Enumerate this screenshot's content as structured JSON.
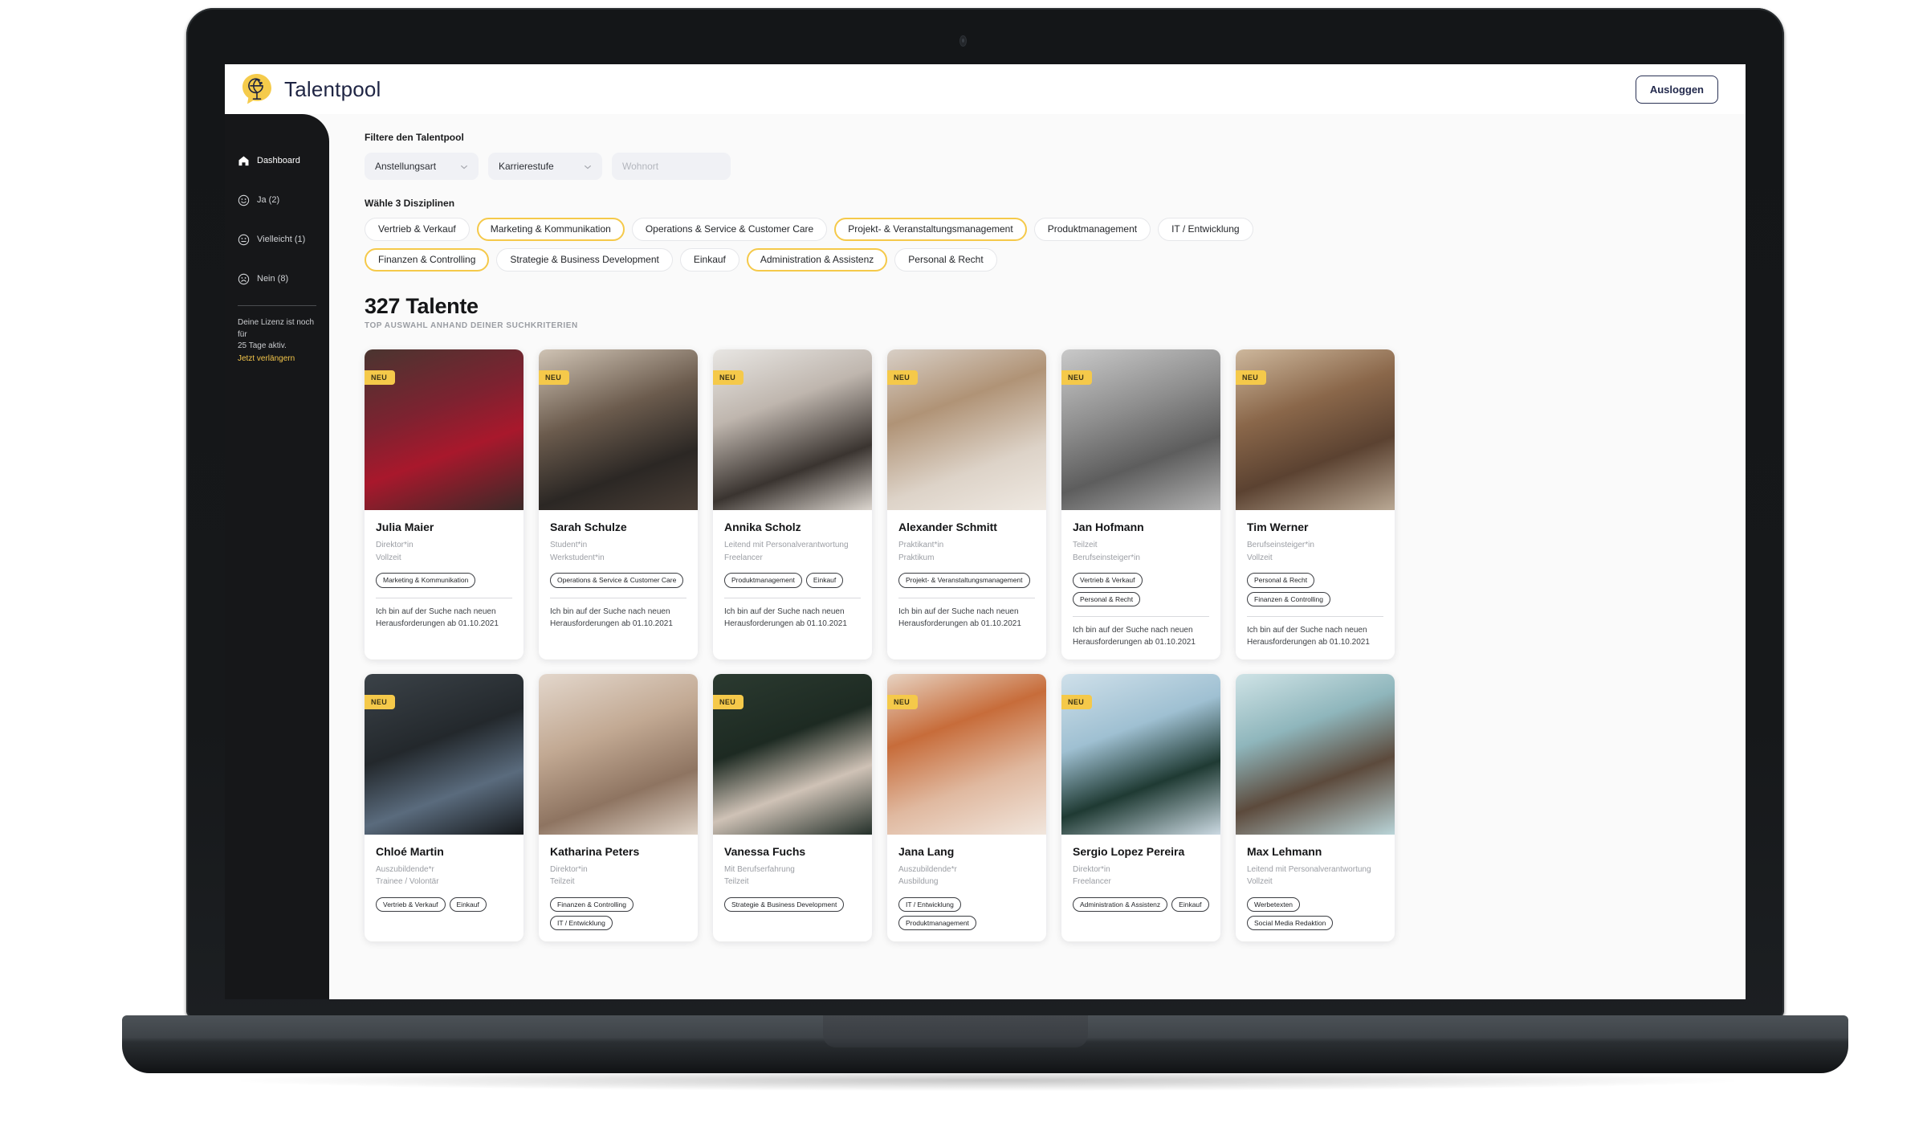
{
  "brand": {
    "name": "Talentpool",
    "logo_icon": "globe-speech-bubble-icon"
  },
  "topbar": {
    "logout_label": "Ausloggen"
  },
  "sidebar": {
    "items": [
      {
        "label": "Dashboard",
        "icon": "home-icon"
      },
      {
        "label": "Ja (2)",
        "icon": "smiley-happy-icon"
      },
      {
        "label": "Vielleicht (1)",
        "icon": "smiley-neutral-icon"
      },
      {
        "label": "Nein (8)",
        "icon": "smiley-sad-icon"
      }
    ],
    "license": {
      "line1": "Deine Lizenz ist noch für",
      "line2": "25 Tage aktiv.",
      "renew_label": "Jetzt verlängern"
    }
  },
  "filters": {
    "heading": "Filtere den Talentpool",
    "employment": {
      "label": "Anstellungsart",
      "icon": "chevron-down-icon"
    },
    "career": {
      "label": "Karrierestufe",
      "icon": "chevron-down-icon"
    },
    "location": {
      "value": "",
      "placeholder": "Wohnort"
    }
  },
  "disciplines": {
    "heading": "Wähle 3 Disziplinen",
    "items": [
      {
        "label": "Vertrieb & Verkauf",
        "selected": false
      },
      {
        "label": "Marketing & Kommunikation",
        "selected": true
      },
      {
        "label": "Operations & Service & Customer Care",
        "selected": false
      },
      {
        "label": "Projekt- & Veranstaltungsmanagement",
        "selected": true
      },
      {
        "label": "Produktmanagement",
        "selected": false
      },
      {
        "label": "IT / Entwicklung",
        "selected": false
      },
      {
        "label": "Finanzen & Controlling",
        "selected": true
      },
      {
        "label": "Strategie & Business Development",
        "selected": false
      },
      {
        "label": "Einkauf",
        "selected": false
      },
      {
        "label": "Administration & Assistenz",
        "selected": true
      },
      {
        "label": "Personal & Recht",
        "selected": false
      }
    ]
  },
  "results": {
    "count_title": "327 Talente",
    "subtitle": "TOP AUSWAHL ANHAND DEINER SUCHKRITERIEN",
    "badge_new_label": "NEU",
    "talents": [
      {
        "name": "Julia Maier",
        "level": "Direktor*in",
        "employment": "Vollzeit",
        "tags": [
          "Marketing & Kommunikation"
        ],
        "note": "Ich bin auf der Suche nach neuen Herausforderungen ab 01.10.2021",
        "is_new": true,
        "photo": "woman-red-sweater-laughing"
      },
      {
        "name": "Sarah Schulze",
        "level": "Student*in",
        "employment": "Werkstudent*in",
        "tags": [
          "Operations & Service & Customer Care"
        ],
        "note": "Ich bin auf der Suche nach neuen Herausforderungen ab 01.10.2021",
        "is_new": true,
        "photo": "woman-dark-top-outdoor"
      },
      {
        "name": "Annika Scholz",
        "level": "Leitend mit Personalverantwortung",
        "employment": "Freelancer",
        "tags": [
          "Produktmanagement",
          "Einkauf"
        ],
        "note": "Ich bin auf der Suche nach neuen Herausforderungen ab 01.10.2021",
        "is_new": true,
        "photo": "woman-bun-white-shirt"
      },
      {
        "name": "Alexander Schmitt",
        "level": "Praktikant*in",
        "employment": "Praktikum",
        "tags": [
          "Projekt- & Veranstaltungsmanagement"
        ],
        "note": "Ich bin auf der Suche nach neuen Herausforderungen ab 01.10.2021",
        "is_new": true,
        "photo": "man-curly-hair-white-tee"
      },
      {
        "name": "Jan Hofmann",
        "level": "Teilzeit",
        "employment": "Berufseinsteiger*in",
        "tags": [
          "Vertrieb & Verkauf",
          "Personal & Recht"
        ],
        "note": "Ich bin auf der Suche nach neuen Herausforderungen ab 01.10.2021",
        "is_new": true,
        "photo": "man-bw-smiling"
      },
      {
        "name": "Tim Werner",
        "level": "Berufseinsteiger*in",
        "employment": "Vollzeit",
        "tags": [
          "Personal & Recht",
          "Finanzen & Controlling"
        ],
        "note": "Ich bin auf der Suche nach neuen Herausforderungen ab 01.10.2021",
        "is_new": true,
        "photo": "man-smiling-brick-wall"
      },
      {
        "name": "Chloé Martin",
        "level": "Auszubildende*r",
        "employment": "Trainee / Volontär",
        "tags": [
          "Vertrieb & Verkauf",
          "Einkauf"
        ],
        "note": "",
        "is_new": true,
        "photo": "woman-denim-jacket-dark"
      },
      {
        "name": "Katharina Peters",
        "level": "Direktor*in",
        "employment": "Teilzeit",
        "tags": [
          "Finanzen & Controlling",
          "IT / Entwicklung"
        ],
        "note": "",
        "is_new": false,
        "photo": "woman-freckles-portrait"
      },
      {
        "name": "Vanessa Fuchs",
        "level": "Mit Berufserfahrung",
        "employment": "Teilzeit",
        "tags": [
          "Strategie & Business Development"
        ],
        "note": "",
        "is_new": true,
        "photo": "woman-hat-green-backdrop"
      },
      {
        "name": "Jana Lang",
        "level": "Auszubildende*r",
        "employment": "Ausbildung",
        "tags": [
          "IT / Entwicklung",
          "Produktmanagement"
        ],
        "note": "",
        "is_new": true,
        "photo": "woman-red-hair-laughing"
      },
      {
        "name": "Sergio Lopez Pereira",
        "level": "Direktor*in",
        "employment": "Freelancer",
        "tags": [
          "Administration & Assistenz",
          "Einkauf"
        ],
        "note": "",
        "is_new": true,
        "photo": "man-orange-beanie-rooftop"
      },
      {
        "name": "Max Lehmann",
        "level": "Leitend mit Personalverantwortung",
        "employment": "Vollzeit",
        "tags": [
          "Werbetexten",
          "Social Media Redaktion"
        ],
        "note": "",
        "is_new": false,
        "photo": "man-glasses-floral-shirt"
      }
    ]
  },
  "colors": {
    "accent": "#f5c94a",
    "sidebar": "#161719",
    "page_bg": "#fafafa",
    "brand_text": "#1f2544"
  }
}
